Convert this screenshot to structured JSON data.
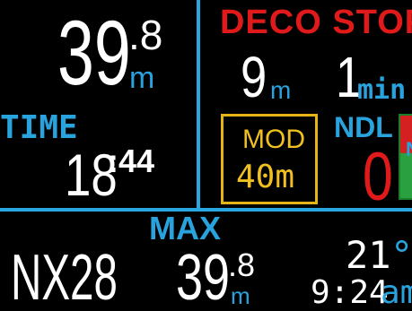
{
  "depth": {
    "whole": "39",
    "decimal": ".8",
    "unit": "m"
  },
  "time": {
    "label": "TIME",
    "minutes": "18",
    "seconds": ":44"
  },
  "deco": {
    "label": "DECO STOP",
    "depth_value": "9",
    "depth_unit": "m",
    "time_value": "1",
    "time_unit": "min"
  },
  "mod": {
    "label": "MOD",
    "value": "40m"
  },
  "ndl": {
    "label": "NDL",
    "value": "0",
    "bar_letter": "N"
  },
  "max": {
    "label": "MAX",
    "whole": "39",
    "decimal": ".8",
    "unit": "m"
  },
  "gas": {
    "mix": "NX28"
  },
  "temperature": {
    "value": "21",
    "unit": "°C"
  },
  "clock": {
    "time": "9:24",
    "suffix": "am"
  },
  "colors": {
    "accent_blue": "#29a3de",
    "alert_red": "#e01a1a",
    "mod_yellow": "#f0c020"
  }
}
